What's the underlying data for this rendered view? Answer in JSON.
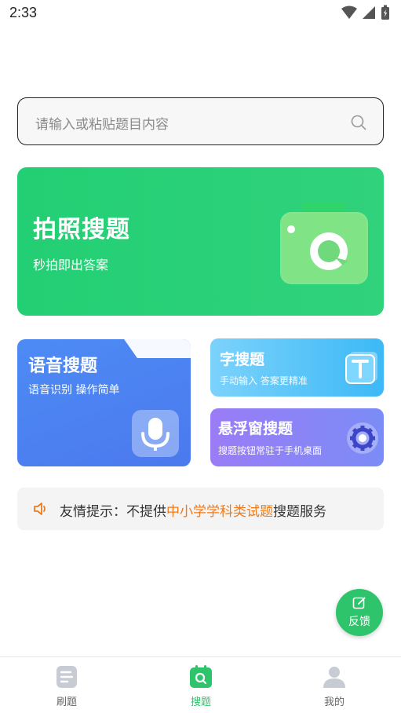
{
  "status_bar": {
    "time": "2:33",
    "icons": [
      "wifi-icon",
      "signal-icon",
      "battery-icon"
    ]
  },
  "search": {
    "placeholder": "请输入或粘贴题目内容"
  },
  "photo_card": {
    "title": "拍照搜题",
    "subtitle": "秒拍即出答案"
  },
  "voice_card": {
    "title": "语音搜题",
    "subtitle": "语音识别 操作简单"
  },
  "text_card": {
    "title": "字搜题",
    "subtitle": "手动输入 答案更精准"
  },
  "float_card": {
    "title": "悬浮窗搜题",
    "subtitle": "搜题按钮常驻于手机桌面"
  },
  "tip": {
    "prefix": "友情提示：不提供",
    "highlight": "中小学学科类试题",
    "suffix": "搜题服务"
  },
  "feedback": {
    "label": "反馈"
  },
  "tabs": [
    {
      "label": "刷题",
      "icon": "document-icon",
      "active": false
    },
    {
      "label": "搜题",
      "icon": "search-calendar-icon",
      "active": true
    },
    {
      "label": "我的",
      "icon": "user-icon",
      "active": false
    }
  ],
  "colors": {
    "accent": "#2ec46c",
    "photo_card": "#26d076",
    "voice_card": "#4b83f2",
    "text_card": "#4cbdf7",
    "float_card": "#8a84f6",
    "tip_highlight": "#f07a1a"
  }
}
